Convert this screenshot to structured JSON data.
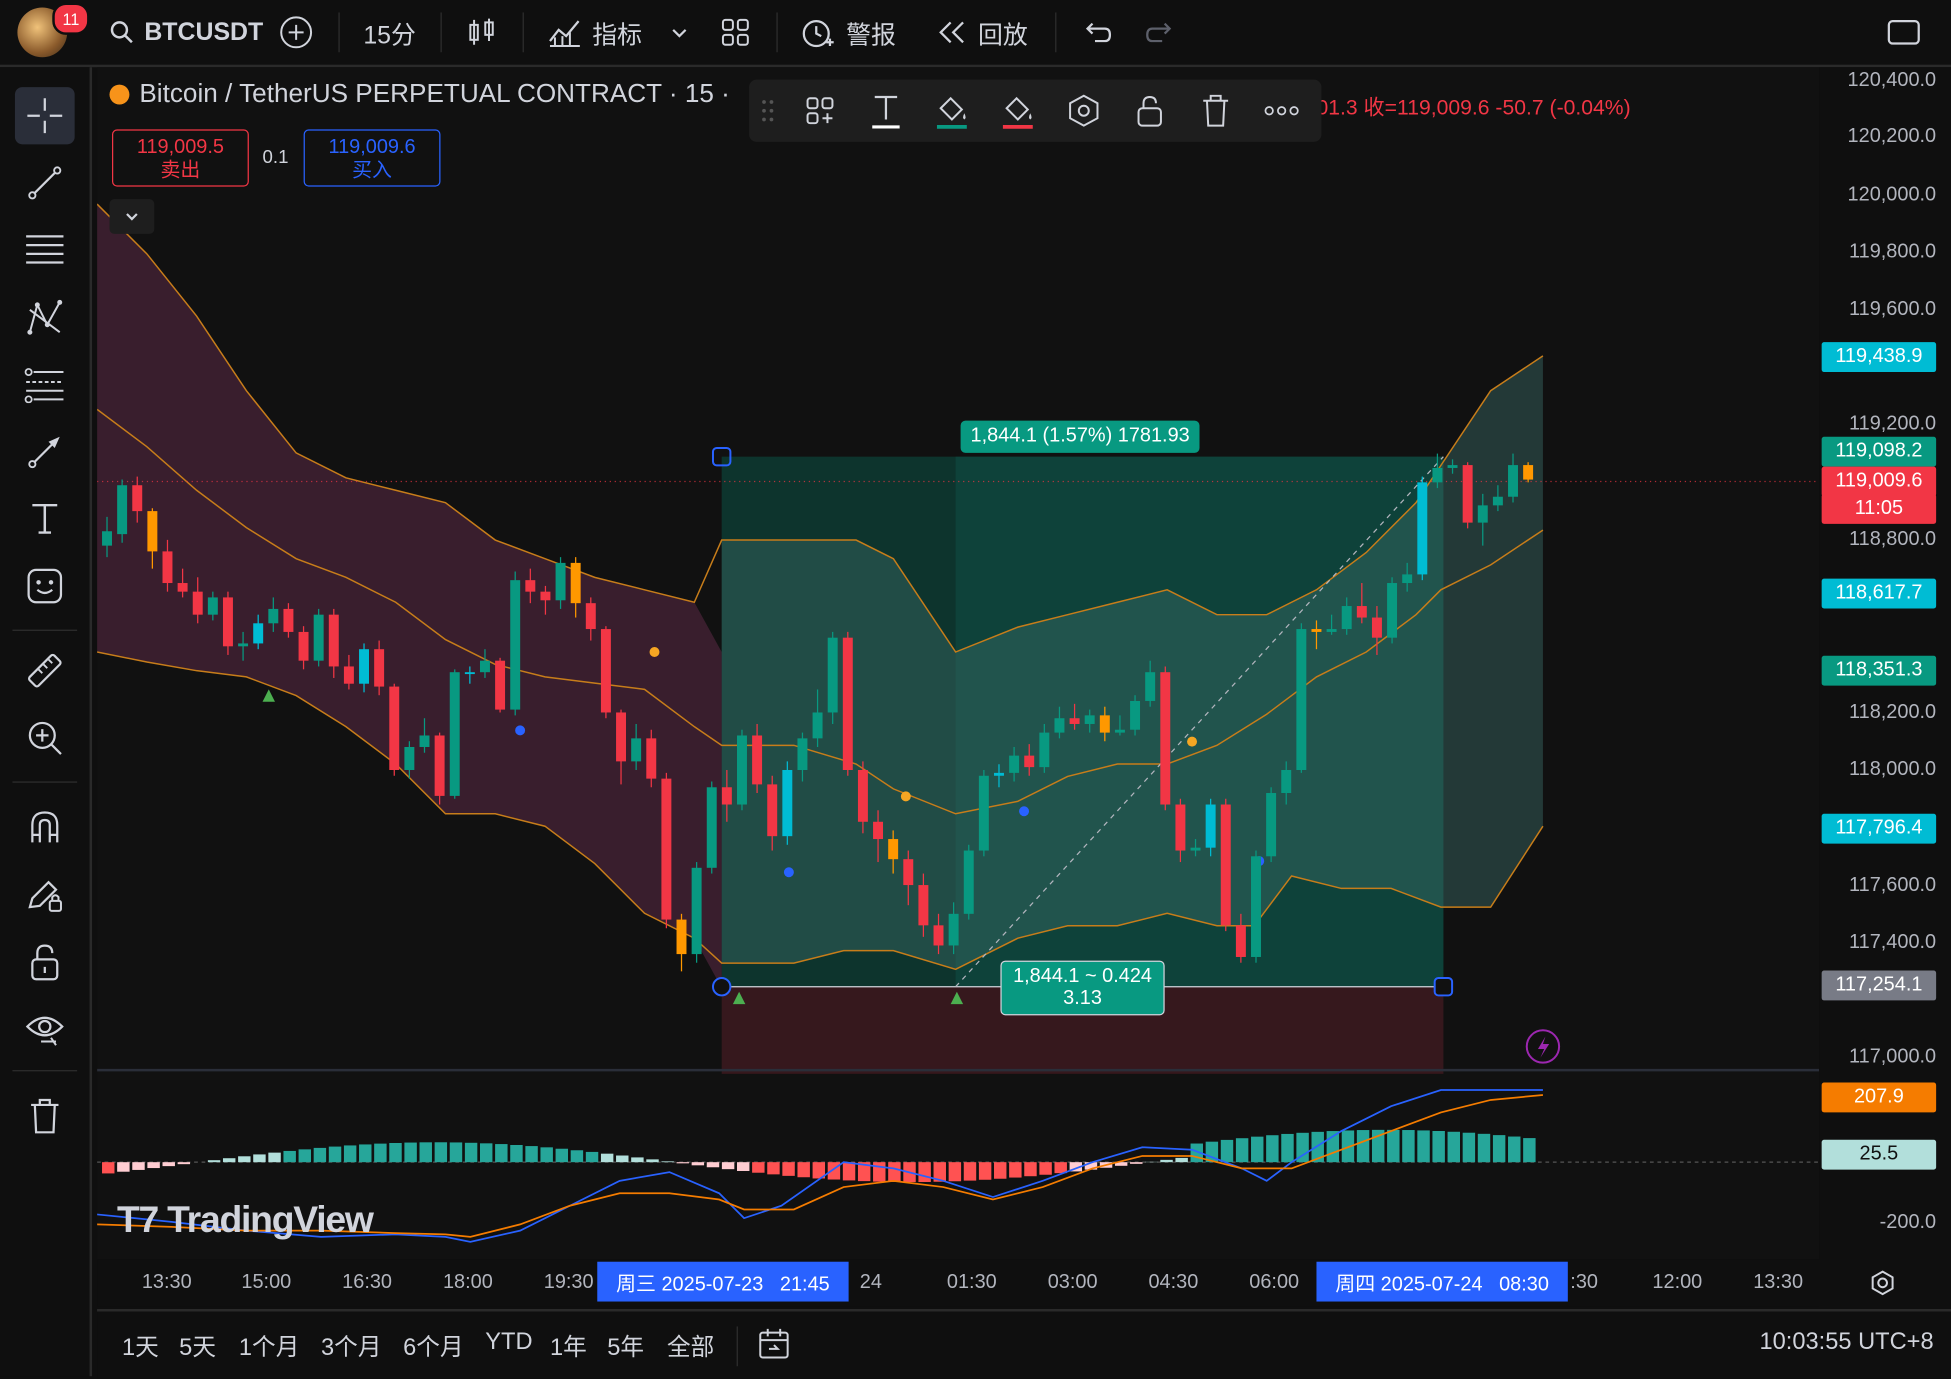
{
  "topbar": {
    "notification_count": "11",
    "symbol": "BTCUSDT",
    "interval": "15分",
    "indicators_label": "指标",
    "alert_label": "警报",
    "replay_label": "回放"
  },
  "legend": {
    "title": "Bitcoin / TetherUS PERPETUAL CONTRACT · 15 ·",
    "ohlc_text": "01.3 收=119,009.6 -50.7 (-0.04%)",
    "sell_price": "119,009.5",
    "sell_label": "卖出",
    "spread": "0.1",
    "buy_price": "119,009.6",
    "buy_label": "买入"
  },
  "position_tool": {
    "top_label": "1,844.1 (1.57%) 1781.93",
    "bottom_label_line1": "1,844.1 ~ 0.424",
    "bottom_label_line2": "3.13"
  },
  "price_axis": {
    "labels": [
      "120,400.0",
      "120,200.0",
      "120,000.0",
      "119,800.0",
      "119,600.0",
      "119,200.0",
      "118,800.0",
      "118,200.0",
      "118,000.0",
      "117,600.0",
      "117,400.0",
      "117,000.0",
      "-200.0"
    ],
    "tags": [
      {
        "text": "119,438.9",
        "color": "#00bcd4"
      },
      {
        "text": "119,098.2",
        "color": "#089981"
      },
      {
        "text": "119,009.6",
        "color": "#f23645"
      },
      {
        "text": "11:05",
        "color": "#f23645"
      },
      {
        "text": "118,617.7",
        "color": "#00bcd4"
      },
      {
        "text": "118,351.3",
        "color": "#089981"
      },
      {
        "text": "117,796.4",
        "color": "#00bcd4"
      },
      {
        "text": "117,254.1",
        "color": "#787b86"
      },
      {
        "text": "207.9",
        "color": "#f57c00"
      },
      {
        "text": "25.5",
        "color": "#b2dfdb"
      }
    ]
  },
  "time_axis": {
    "labels": [
      "13:30",
      "15:00",
      "16:30",
      "18:00",
      "19:30",
      "24",
      "01:30",
      "03:00",
      "04:30",
      "06:00",
      ":30",
      "12:00",
      "13:30"
    ],
    "highlight_left": "周三 2025-07-23   21:45",
    "highlight_right": "周四 2025-07-24   08:30"
  },
  "bottombar": {
    "ranges": [
      "1天",
      "5天",
      "1个月",
      "3个月",
      "6个月",
      "YTD",
      "1年",
      "5年",
      "全部"
    ],
    "clock": "10:03:55 UTC+8"
  },
  "watermark": "TradingView",
  "chart_data": {
    "type": "candlestick",
    "title": "Bitcoin / TetherUS PERPETUAL CONTRACT · 15",
    "ylim": [
      117000,
      120400
    ],
    "colors": {
      "up": "#089981",
      "down": "#f23645",
      "alt_up": "#00bcd4",
      "alt_down": "#ff9800"
    },
    "candles": [
      {
        "o": 118780,
        "c": 118830,
        "h": 118880,
        "l": 118740
      },
      {
        "o": 118820,
        "c": 118990,
        "h": 119010,
        "l": 118790
      },
      {
        "o": 118990,
        "c": 118900,
        "h": 119020,
        "l": 118860
      },
      {
        "o": 118900,
        "c": 118760,
        "h": 118910,
        "l": 118700
      },
      {
        "o": 118760,
        "c": 118650,
        "h": 118800,
        "l": 118620
      },
      {
        "o": 118650,
        "c": 118620,
        "h": 118700,
        "l": 118600
      },
      {
        "o": 118620,
        "c": 118540,
        "h": 118670,
        "l": 118510
      },
      {
        "o": 118540,
        "c": 118600,
        "h": 118620,
        "l": 118520
      },
      {
        "o": 118600,
        "c": 118430,
        "h": 118620,
        "l": 118400
      },
      {
        "o": 118430,
        "c": 118440,
        "h": 118480,
        "l": 118380
      },
      {
        "o": 118440,
        "c": 118510,
        "h": 118540,
        "l": 118420
      },
      {
        "o": 118510,
        "c": 118560,
        "h": 118600,
        "l": 118480
      },
      {
        "o": 118560,
        "c": 118480,
        "h": 118580,
        "l": 118460
      },
      {
        "o": 118480,
        "c": 118380,
        "h": 118500,
        "l": 118350
      },
      {
        "o": 118380,
        "c": 118540,
        "h": 118560,
        "l": 118360
      },
      {
        "o": 118540,
        "c": 118360,
        "h": 118560,
        "l": 118320
      },
      {
        "o": 118360,
        "c": 118300,
        "h": 118400,
        "l": 118280
      },
      {
        "o": 118300,
        "c": 118420,
        "h": 118440,
        "l": 118270
      },
      {
        "o": 118420,
        "c": 118290,
        "h": 118450,
        "l": 118260
      },
      {
        "o": 118290,
        "c": 118000,
        "h": 118300,
        "l": 117980
      },
      {
        "o": 118000,
        "c": 118080,
        "h": 118100,
        "l": 117970
      },
      {
        "o": 118080,
        "c": 118120,
        "h": 118180,
        "l": 118060
      },
      {
        "o": 118120,
        "c": 117910,
        "h": 118130,
        "l": 117880
      },
      {
        "o": 117910,
        "c": 118340,
        "h": 118350,
        "l": 117900
      },
      {
        "o": 118340,
        "c": 118340,
        "h": 118360,
        "l": 118300
      },
      {
        "o": 118340,
        "c": 118380,
        "h": 118420,
        "l": 118320
      },
      {
        "o": 118380,
        "c": 118210,
        "h": 118390,
        "l": 118200
      },
      {
        "o": 118210,
        "c": 118660,
        "h": 118690,
        "l": 118190
      },
      {
        "o": 118660,
        "c": 118620,
        "h": 118700,
        "l": 118580
      },
      {
        "o": 118620,
        "c": 118590,
        "h": 118640,
        "l": 118540
      },
      {
        "o": 118590,
        "c": 118720,
        "h": 118740,
        "l": 118560
      },
      {
        "o": 118720,
        "c": 118580,
        "h": 118740,
        "l": 118530
      },
      {
        "o": 118580,
        "c": 118490,
        "h": 118600,
        "l": 118450
      },
      {
        "o": 118490,
        "c": 118200,
        "h": 118500,
        "l": 118180
      },
      {
        "o": 118200,
        "c": 118030,
        "h": 118210,
        "l": 117950
      },
      {
        "o": 118030,
        "c": 118110,
        "h": 118160,
        "l": 118000
      },
      {
        "o": 118110,
        "c": 117970,
        "h": 118140,
        "l": 117940
      },
      {
        "o": 117970,
        "c": 117480,
        "h": 117990,
        "l": 117450
      },
      {
        "o": 117480,
        "c": 117360,
        "h": 117500,
        "l": 117300
      },
      {
        "o": 117360,
        "c": 117660,
        "h": 117680,
        "l": 117330
      },
      {
        "o": 117660,
        "c": 117940,
        "h": 117960,
        "l": 117640
      },
      {
        "o": 117940,
        "c": 117880,
        "h": 118000,
        "l": 117820
      },
      {
        "o": 117880,
        "c": 118120,
        "h": 118140,
        "l": 117860
      },
      {
        "o": 118120,
        "c": 117950,
        "h": 118160,
        "l": 117920
      },
      {
        "o": 117950,
        "c": 117770,
        "h": 117980,
        "l": 117720
      },
      {
        "o": 117770,
        "c": 118000,
        "h": 118030,
        "l": 117740
      },
      {
        "o": 118000,
        "c": 118110,
        "h": 118130,
        "l": 117960
      },
      {
        "o": 118110,
        "c": 118200,
        "h": 118280,
        "l": 118080
      },
      {
        "o": 118200,
        "c": 118460,
        "h": 118480,
        "l": 118160
      },
      {
        "o": 118460,
        "c": 118000,
        "h": 118480,
        "l": 117980
      },
      {
        "o": 118000,
        "c": 117820,
        "h": 118030,
        "l": 117780
      },
      {
        "o": 117820,
        "c": 117760,
        "h": 117860,
        "l": 117680
      },
      {
        "o": 117760,
        "c": 117690,
        "h": 117790,
        "l": 117640
      },
      {
        "o": 117690,
        "c": 117600,
        "h": 117720,
        "l": 117530
      },
      {
        "o": 117600,
        "c": 117460,
        "h": 117640,
        "l": 117420
      },
      {
        "o": 117460,
        "c": 117390,
        "h": 117500,
        "l": 117360
      },
      {
        "o": 117390,
        "c": 117500,
        "h": 117540,
        "l": 117360
      },
      {
        "o": 117500,
        "c": 117720,
        "h": 117740,
        "l": 117480
      },
      {
        "o": 117720,
        "c": 117980,
        "h": 118000,
        "l": 117700
      },
      {
        "o": 117980,
        "c": 117990,
        "h": 118020,
        "l": 117940
      },
      {
        "o": 117990,
        "c": 118050,
        "h": 118080,
        "l": 117960
      },
      {
        "o": 118050,
        "c": 118010,
        "h": 118090,
        "l": 117980
      },
      {
        "o": 118010,
        "c": 118130,
        "h": 118160,
        "l": 117990
      },
      {
        "o": 118130,
        "c": 118180,
        "h": 118220,
        "l": 118110
      },
      {
        "o": 118180,
        "c": 118160,
        "h": 118230,
        "l": 118140
      },
      {
        "o": 118160,
        "c": 118190,
        "h": 118210,
        "l": 118130
      },
      {
        "o": 118190,
        "c": 118130,
        "h": 118220,
        "l": 118100
      },
      {
        "o": 118130,
        "c": 118140,
        "h": 118190,
        "l": 118120
      },
      {
        "o": 118140,
        "c": 118240,
        "h": 118260,
        "l": 118120
      },
      {
        "o": 118240,
        "c": 118340,
        "h": 118380,
        "l": 118220
      },
      {
        "o": 118340,
        "c": 117880,
        "h": 118360,
        "l": 117860
      },
      {
        "o": 117880,
        "c": 117720,
        "h": 117900,
        "l": 117680
      },
      {
        "o": 117720,
        "c": 117730,
        "h": 117760,
        "l": 117700
      },
      {
        "o": 117730,
        "c": 117880,
        "h": 117900,
        "l": 117700
      },
      {
        "o": 117880,
        "c": 117460,
        "h": 117900,
        "l": 117440
      },
      {
        "o": 117460,
        "c": 117350,
        "h": 117500,
        "l": 117330
      },
      {
        "o": 117350,
        "c": 117700,
        "h": 117720,
        "l": 117330
      },
      {
        "o": 117700,
        "c": 117920,
        "h": 117940,
        "l": 117680
      },
      {
        "o": 117920,
        "c": 118000,
        "h": 118030,
        "l": 117880
      },
      {
        "o": 118000,
        "c": 118490,
        "h": 118510,
        "l": 117990
      },
      {
        "o": 118490,
        "c": 118480,
        "h": 118520,
        "l": 118420
      },
      {
        "o": 118480,
        "c": 118490,
        "h": 118540,
        "l": 118470
      },
      {
        "o": 118490,
        "c": 118570,
        "h": 118600,
        "l": 118470
      },
      {
        "o": 118570,
        "c": 118530,
        "h": 118650,
        "l": 118510
      },
      {
        "o": 118530,
        "c": 118460,
        "h": 118570,
        "l": 118400
      },
      {
        "o": 118460,
        "c": 118650,
        "h": 118670,
        "l": 118440
      },
      {
        "o": 118650,
        "c": 118680,
        "h": 118720,
        "l": 118620
      },
      {
        "o": 118680,
        "c": 119000,
        "h": 119020,
        "l": 118660
      },
      {
        "o": 119000,
        "c": 119050,
        "h": 119100,
        "l": 118980
      },
      {
        "o": 119050,
        "c": 119060,
        "h": 119080,
        "l": 119030
      },
      {
        "o": 119060,
        "c": 118860,
        "h": 119070,
        "l": 118840
      },
      {
        "o": 118860,
        "c": 118920,
        "h": 118960,
        "l": 118780
      },
      {
        "o": 118920,
        "c": 118950,
        "h": 118990,
        "l": 118900
      },
      {
        "o": 118950,
        "c": 119060,
        "h": 119100,
        "l": 118930
      },
      {
        "o": 119060,
        "c": 119009.6,
        "h": 119070,
        "l": 119000
      }
    ]
  }
}
